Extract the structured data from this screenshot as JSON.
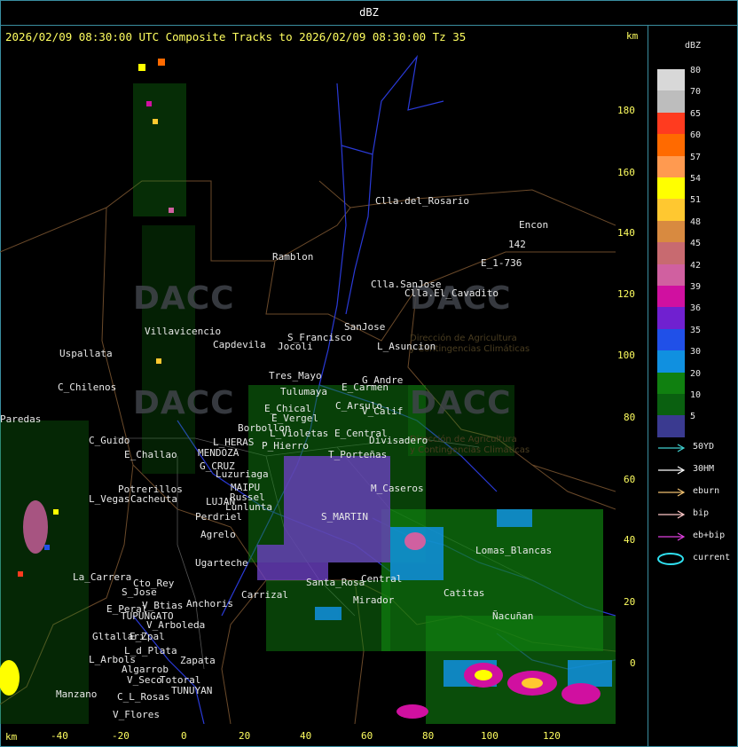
{
  "window": {
    "unit_title": "dBZ",
    "header": "2026/02/09 08:30:00 UTC Composite Tracks to 2026/02/09 08:30:00 Tz 35",
    "km_top": "km",
    "km_bottom": "km"
  },
  "axes": {
    "x_ticks": [
      "-40",
      "-20",
      "0",
      "20",
      "40",
      "60",
      "80",
      "100",
      "120"
    ],
    "y_ticks": [
      "180",
      "160",
      "140",
      "120",
      "100",
      "80",
      "60",
      "40",
      "20",
      "0"
    ]
  },
  "watermark": {
    "brand": "DACC",
    "line1": "Dirección de Agricultura",
    "line2": "y Contingencias Climáticas"
  },
  "places": [
    "Clla.del_Rosario",
    "Encon",
    "E_1-736",
    "142",
    "Ramblon",
    "Clla.SanJose",
    "Clla.El_Cavadito",
    "Villavicencio",
    "S_Francisco",
    "SanJose",
    "Capdevila",
    "L_Asuncion",
    "Jocoli",
    "Uspallata",
    "Tres_Mayo",
    "Tulumaya",
    "G_Andre",
    "E_Carmen",
    "C_Chilenos",
    "E_Chical",
    "C_Arsulo",
    "V_Calif",
    "E_Vergel",
    "L_Violetas",
    "E_Central",
    "Borbollon",
    "L_HERAS",
    "P_Hierro",
    "Divisadero",
    "C_Guido",
    "MENDOZA",
    "T_Porteñas",
    "E_Challao",
    "G_CRUZ",
    "Luzuriaga",
    "M_Caseros",
    "MAIPU",
    "Russel",
    "Potrerillos",
    "L_Vegas",
    "Cacheuta",
    "LUJAN",
    "Lunlunta",
    "S_MARTIN",
    "Perdriel",
    "Agrelo",
    "Ugarteche",
    "Lomas_Blancas",
    "La_Carrera",
    "Cto_Rey",
    "S_Jose",
    "Carrizal",
    "Central",
    "Santa_Rosa",
    "Tupungato",
    "TUPUNGATO",
    "E_Peral",
    "V_Btias",
    "Anchoris",
    "Mirador",
    "Catitas",
    "Ñacuñan",
    "V_Arboleda",
    "Gltallari",
    "E_Zpal",
    "L_d_Plata",
    "L_Arbols",
    "Zapata",
    "Algarrob",
    "V_Seco",
    "Totoral",
    "TUNUYAN",
    "Manzano",
    "C_L_Rosas",
    "V_Flores",
    "Paredas"
  ],
  "legend": {
    "title": "dBZ",
    "levels": [
      {
        "value": "80",
        "color": "#d8d8d8"
      },
      {
        "value": "70",
        "color": "#bdbdbd"
      },
      {
        "value": "65",
        "color": "#ff3b1f"
      },
      {
        "value": "60",
        "color": "#ff6a00"
      },
      {
        "value": "57",
        "color": "#ff9a50"
      },
      {
        "value": "54",
        "color": "#ffff00"
      },
      {
        "value": "51",
        "color": "#ffc830"
      },
      {
        "value": "48",
        "color": "#d88a40"
      },
      {
        "value": "45",
        "color": "#c86a70"
      },
      {
        "value": "42",
        "color": "#d060a0"
      },
      {
        "value": "39",
        "color": "#d010a0"
      },
      {
        "value": "36",
        "color": "#7020d0"
      },
      {
        "value": "35",
        "color": "#2050e8"
      },
      {
        "value": "30",
        "color": "#1090e0"
      },
      {
        "value": "20",
        "color": "#108010"
      },
      {
        "value": "10",
        "color": "#0a6010"
      },
      {
        "value": "5",
        "color": "#3a3a90"
      }
    ],
    "tracks": [
      {
        "label": "50YD",
        "color": "#40d0d0"
      },
      {
        "label": "30HM",
        "color": "#ffffff"
      },
      {
        "label": "eburn",
        "color": "#f0c070"
      },
      {
        "label": "bip",
        "color": "#ffc8c8"
      },
      {
        "label": "eb+bip",
        "color": "#e040e0"
      },
      {
        "label": "current",
        "color": "#30e0f0"
      }
    ]
  }
}
